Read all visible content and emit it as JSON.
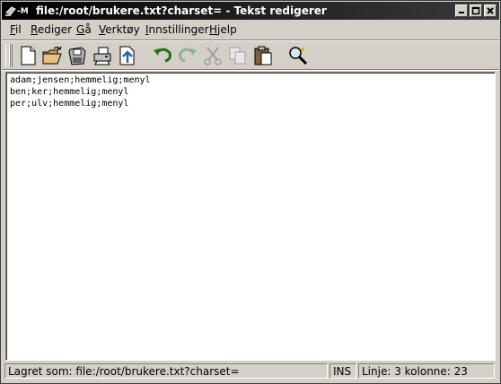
{
  "window": {
    "title": "file:/root/brukere.txt?charset= - Tekst redigerer"
  },
  "menu": {
    "items": [
      {
        "first": "F",
        "rest": "il"
      },
      {
        "first": "R",
        "rest": "ediger"
      },
      {
        "first": "G",
        "rest": "å"
      },
      {
        "first": "V",
        "rest": "erktøy"
      },
      {
        "first": "I",
        "rest": "nnstillinger"
      },
      {
        "first": "H",
        "rest": "jelp"
      }
    ]
  },
  "toolbar": {
    "icons": [
      "new-document-icon",
      "open-folder-icon",
      "save-disk-icon",
      "print-icon",
      "export-icon",
      "undo-icon",
      "redo-icon",
      "cut-icon",
      "copy-icon",
      "paste-icon",
      "find-icon"
    ]
  },
  "editor": {
    "lines": [
      "adam;jensen;hemmelig;menyl",
      "ben;ker;hemmelig;menyl",
      "per;ulv;hemmelig;menyl"
    ]
  },
  "status": {
    "message": "Lagret som: file:/root/brukere.txt?charset=",
    "mode": "INS",
    "position": "Linje: 3 kolonne: 23"
  }
}
